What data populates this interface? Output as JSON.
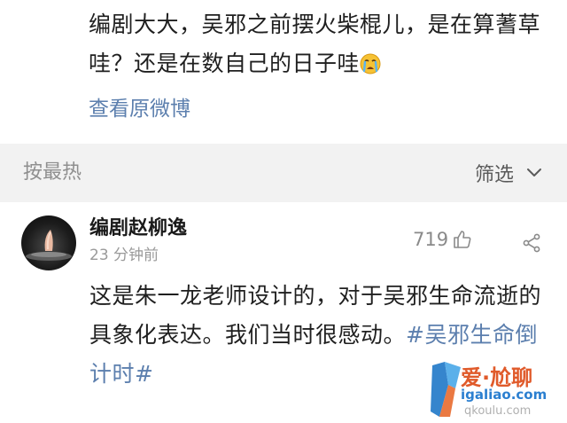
{
  "post": {
    "text": "编剧大大，吴邪之前摆火柴棍儿，是在算蓍草哇？还是在数自己的日子哇",
    "emoji_icon": "crying-face-icon",
    "view_original": "查看原微博"
  },
  "filter_bar": {
    "sort_label": "按最热",
    "filter_label": "筛选",
    "filter_icon": "chevron-down-icon"
  },
  "comment": {
    "author": "编剧赵柳逸",
    "time": "23 分钟前",
    "likes": "719",
    "text": "这是朱一龙老师设计的，对于吴邪生命流逝的具象化表达。我们当时很感动。",
    "hashtag": "#吴邪生命倒计时#"
  },
  "watermark": {
    "main": "爱·尬聊",
    "url": "igaliao.com",
    "sub": "qkoulu.com"
  },
  "colors": {
    "link": "#5c7fae",
    "filter_bg": "#f2f2f2",
    "muted": "#9a9a9a"
  }
}
